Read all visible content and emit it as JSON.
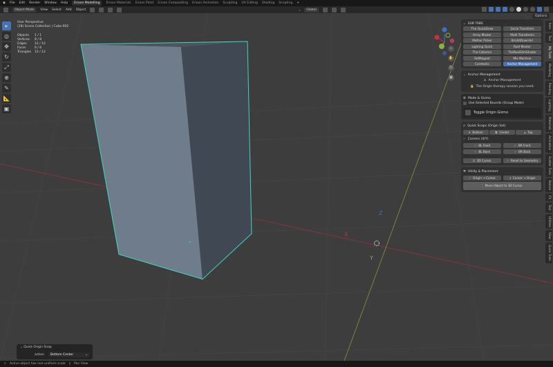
{
  "menu": {
    "items": [
      "File",
      "Edit",
      "Render",
      "Window",
      "Help"
    ],
    "workspaces": [
      "Erixon Modelling",
      "Erixon Materials",
      "Erixon Paint",
      "Erixon Compositing",
      "Erixon Animation",
      "Sculpting",
      "UV Editing",
      "Shading",
      "Scripting"
    ],
    "active_workspace": "Erixon Modelling",
    "add_tab": "+"
  },
  "header": {
    "mode": "Object Mode",
    "menus": [
      "View",
      "Select",
      "Add",
      "Object"
    ],
    "orientation": "Global",
    "options": "Options"
  },
  "overlay": {
    "view": "User Perspective",
    "collection": "(28) Scene Collection | Cube.002",
    "stats": [
      {
        "label": "Objects",
        "value": "1 / 1"
      },
      {
        "label": "Vertices",
        "value": "8 / 8"
      },
      {
        "label": "Edges",
        "value": "12 / 12"
      },
      {
        "label": "Faces",
        "value": "6 / 6"
      },
      {
        "label": "Triangles",
        "value": "12 / 12"
      }
    ]
  },
  "axes": {
    "x": "X",
    "y": "Y",
    "z": "Z"
  },
  "panel": {
    "subtabs_title": "SUB TABS",
    "subtabs": [
      "The QuickDraw",
      "Quick Transform",
      "Array Master",
      "Multi Transforms",
      "Mother Picker",
      "BrickItDownYo!",
      "Lighting Quick",
      "Roof Master",
      "The Collector",
      "TheRealSlimShader",
      "RefMagnet",
      "Mix Machine",
      "Camtastic",
      "Anchor Management"
    ],
    "active_subtab": "Anchor Management",
    "anchor_title": "Anchor Management",
    "anchor_label": "Anchor Management",
    "anchor_tagline": "The Origin therapy session you need.",
    "mode_gizmo": "Mode & Gizmo",
    "use_bounds": "Use Selected Bounds (Group Mode)",
    "toggle_gizmo": "Toggle Origin Gizmo",
    "quick_snaps": "Quick Snaps (Origin Set)",
    "snaps": [
      "Bottom",
      "Center",
      "Top"
    ],
    "corners": "Corners (X/Y)",
    "corner_buttons": [
      "BL Front",
      "BR Front",
      "BL Back",
      "BR Back"
    ],
    "cursor_3d": "3D Cursor",
    "reset_geo": "Reset to Geometry",
    "utility": "Utility & Placement",
    "origin_to_cursor": "Origin → Cursor",
    "cursor_to_origin": "Cursor → Origin",
    "move_object": "Move Object to 3D Cursor"
  },
  "side_tabs": [
    "Item",
    "Tool",
    "My Tools",
    "Modeling",
    "Painting",
    "Lighting",
    "Materials",
    "Animation",
    "Scatter Tools",
    "Nature",
    "FX",
    "Text",
    "Utilities",
    "View",
    "Quick Tools"
  ],
  "active_side_tab": "My Tools",
  "redo": {
    "title": "Quick Origin Snap",
    "action_label": "action",
    "action_value": "Bottom Center"
  },
  "status": {
    "warning": "Active object has non-uniform scale",
    "pan": "Pan View"
  },
  "colors": {
    "accent": "#4772b3",
    "outline": "#3fd9b8",
    "x_axis": "#c9303f",
    "y_axis": "#8db23f",
    "z_axis": "#3e6fd1"
  }
}
